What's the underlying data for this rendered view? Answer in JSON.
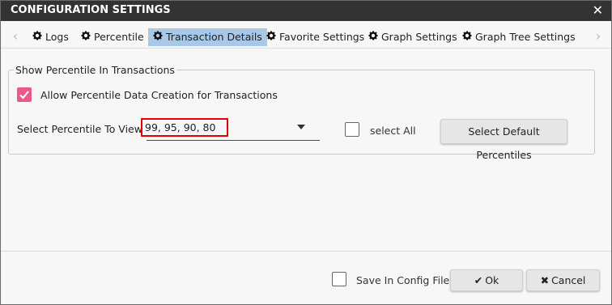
{
  "dialog": {
    "title": "CONFIGURATION SETTINGS",
    "close_icon": "close-icon"
  },
  "tabs": [
    {
      "label": "Logs",
      "icon": "gear-icon",
      "active": false
    },
    {
      "label": "Percentile",
      "icon": "gear-icon",
      "active": false
    },
    {
      "label": "Transaction Details",
      "icon": "gear-icon",
      "active": true
    },
    {
      "label": "Favorite Settings",
      "icon": "gear-icon",
      "active": false
    },
    {
      "label": "Graph Settings",
      "icon": "gear-icon",
      "active": false
    },
    {
      "label": "Graph Tree Settings",
      "icon": "gear-icon",
      "active": false
    }
  ],
  "section": {
    "legend": "Show Percentile In Transactions",
    "allow_checkbox": {
      "label": "Allow Percentile Data Creation for Transactions",
      "checked": true
    },
    "select_label": "Select Percentile To View",
    "select_value": "99,  95,  90,  80",
    "select_all": {
      "label": "select All",
      "checked": false
    },
    "default_button": "Select Default Percentiles"
  },
  "footer": {
    "save_config": {
      "label": "Save In Config File",
      "checked": false
    },
    "ok_label": "Ok",
    "cancel_label": "Cancel"
  },
  "colors": {
    "titlebar": "#333333",
    "active_tab": "#a9c8e6",
    "checkbox_checked": "#e85a8a",
    "highlight_border": "#e00000",
    "dropdown_underline": "#3f3fa3"
  }
}
